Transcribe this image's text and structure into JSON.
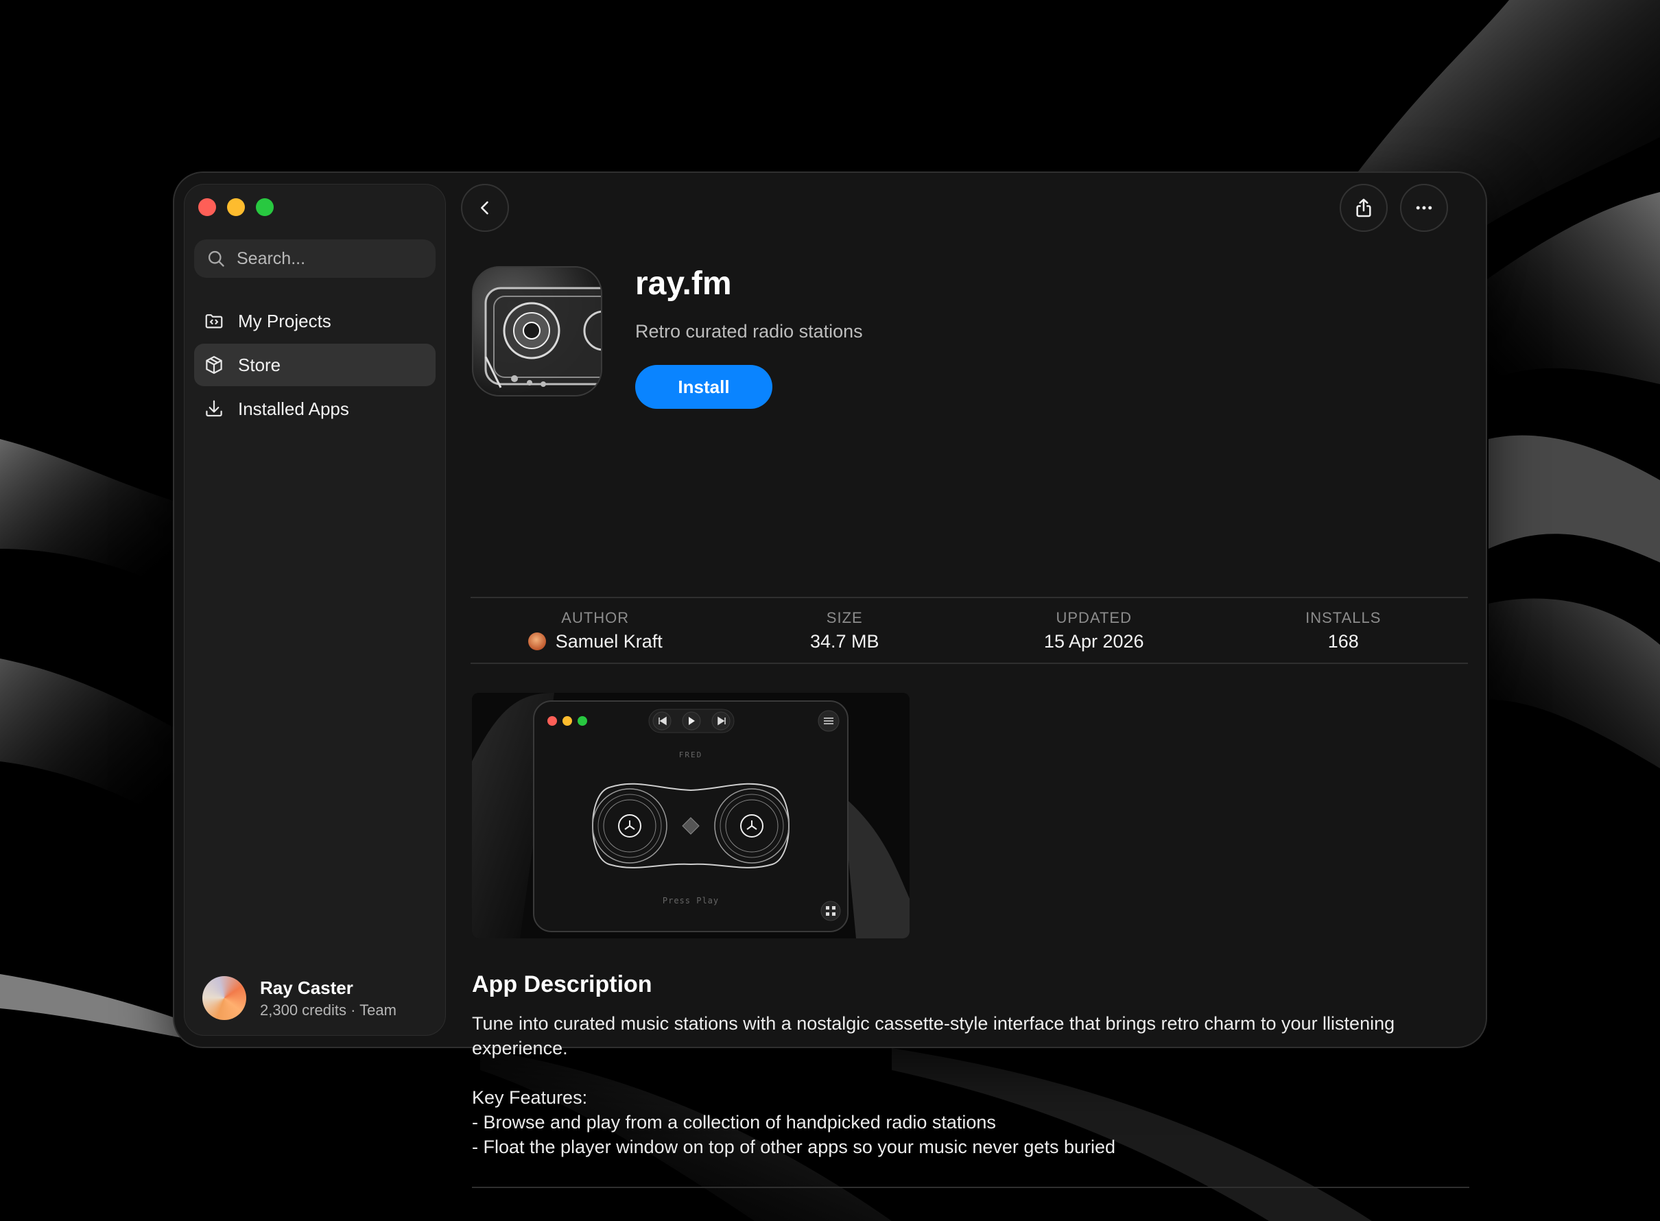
{
  "colors": {
    "accent": "#0a84ff",
    "traffic_red": "#fe5f57",
    "traffic_yellow": "#febc2e",
    "traffic_green": "#28c840"
  },
  "sidebar": {
    "search_placeholder": "Search...",
    "items": [
      {
        "label": "My Projects",
        "icon": "folder-code-icon",
        "active": false
      },
      {
        "label": "Store",
        "icon": "package-icon",
        "active": true
      },
      {
        "label": "Installed Apps",
        "icon": "download-icon",
        "active": false
      }
    ],
    "user": {
      "name": "Ray Caster",
      "meta": "2,300 credits · Team"
    }
  },
  "header": {
    "back_icon": "chevron-left-icon",
    "share_icon": "share-icon",
    "more_icon": "ellipsis-icon"
  },
  "app": {
    "name": "ray.fm",
    "tagline": "Retro curated radio stations",
    "install_label": "Install",
    "meta": [
      {
        "label": "AUTHOR",
        "value": "Samuel Kraft"
      },
      {
        "label": "SIZE",
        "value": "34.7 MB"
      },
      {
        "label": "UPDATED",
        "value": "15 Apr 2026"
      },
      {
        "label": "INSTALLS",
        "value": "168"
      }
    ],
    "screenshot": {
      "station": "FRED",
      "prompt": "Press Play"
    },
    "description_title": "App Description",
    "description_lines": [
      "Tune into curated music stations with a nostalgic cassette-style interface that brings retro charm to your llistening experience.",
      "Key Features:",
      "- Browse and play from a collection of handpicked radio stations",
      "- Float the player window on top of other apps so your music never gets buried"
    ]
  }
}
